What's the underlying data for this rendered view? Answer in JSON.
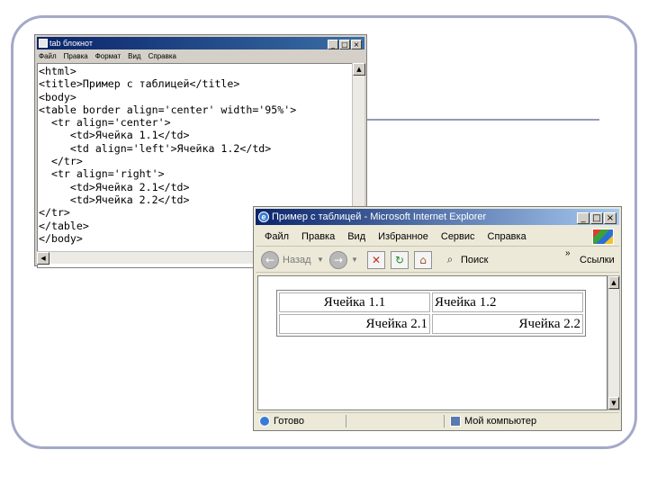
{
  "notepad": {
    "title": "tab блокнот",
    "menu": [
      "Файл",
      "Правка",
      "Формат",
      "Вид",
      "Справка"
    ],
    "code_lines": [
      "<html>",
      "<title>Пример с таблицей</title>",
      "<body>",
      "<table border align='center' width='95%'>",
      "  <tr align='center'>",
      "     <td>Ячейка 1.1</td>",
      "     <td align='left'>Ячейка 1.2</td>",
      "  </tr>",
      "  <tr align='right'>",
      "     <td>Ячейка 2.1</td>",
      "     <td>Ячейка 2.2</td>",
      "</tr>",
      "</table>",
      "</body>"
    ]
  },
  "ie": {
    "title": "Пример с таблицей - Microsoft Internet Explorer",
    "menu": [
      "Файл",
      "Правка",
      "Вид",
      "Избранное",
      "Сервис",
      "Справка"
    ],
    "toolbar": {
      "back_label": "Назад",
      "search_label": "Поиск",
      "links_label": "Ссылки"
    },
    "table": {
      "row1": [
        "Ячейка 1.1",
        "Ячейка 1.2"
      ],
      "row2": [
        "Ячейка 2.1",
        "Ячейка 2.2"
      ]
    },
    "status": {
      "left": "Готово",
      "zone": "Мой компьютер"
    }
  }
}
